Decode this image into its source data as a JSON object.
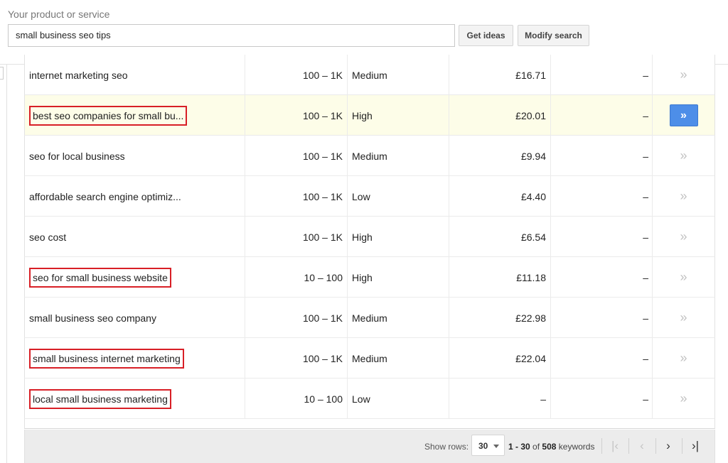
{
  "search": {
    "label": "Your product or service",
    "value": "small business seo tips",
    "get_ideas": "Get ideas",
    "modify": "Modify search"
  },
  "rows": [
    {
      "keyword": "internet marketing seo",
      "avg": "100 – 1K",
      "comp": "Medium",
      "bid": "£16.71",
      "share": "–",
      "boxed": false,
      "highlight": false
    },
    {
      "keyword": "best seo companies for small bu...",
      "avg": "100 – 1K",
      "comp": "High",
      "bid": "£20.01",
      "share": "–",
      "boxed": true,
      "highlight": true
    },
    {
      "keyword": "seo for local business",
      "avg": "100 – 1K",
      "comp": "Medium",
      "bid": "£9.94",
      "share": "–",
      "boxed": false,
      "highlight": false
    },
    {
      "keyword": "affordable search engine optimiz...",
      "avg": "100 – 1K",
      "comp": "Low",
      "bid": "£4.40",
      "share": "–",
      "boxed": false,
      "highlight": false
    },
    {
      "keyword": "seo cost",
      "avg": "100 – 1K",
      "comp": "High",
      "bid": "£6.54",
      "share": "–",
      "boxed": false,
      "highlight": false
    },
    {
      "keyword": "seo for small business website",
      "avg": "10 – 100",
      "comp": "High",
      "bid": "£11.18",
      "share": "–",
      "boxed": true,
      "highlight": false
    },
    {
      "keyword": "small business seo company",
      "avg": "100 – 1K",
      "comp": "Medium",
      "bid": "£22.98",
      "share": "–",
      "boxed": false,
      "highlight": false
    },
    {
      "keyword": "small business internet marketing",
      "avg": "100 – 1K",
      "comp": "Medium",
      "bid": "£22.04",
      "share": "–",
      "boxed": true,
      "highlight": false
    },
    {
      "keyword": "local small business marketing",
      "avg": "10 – 100",
      "comp": "Low",
      "bid": "–",
      "share": "–",
      "boxed": true,
      "highlight": false
    }
  ],
  "add_glyph": "»",
  "pager": {
    "show_rows": "Show rows:",
    "rows_value": "30",
    "range_start": "1 - 30",
    "of": "of",
    "total": "508",
    "unit": "keywords",
    "first": "|‹",
    "prev": "‹",
    "next": "›",
    "last": "›|"
  },
  "colors": {
    "accent": "#4d8ee8",
    "highlight_row": "#fdfde8",
    "annotation_box": "#d81f26"
  }
}
